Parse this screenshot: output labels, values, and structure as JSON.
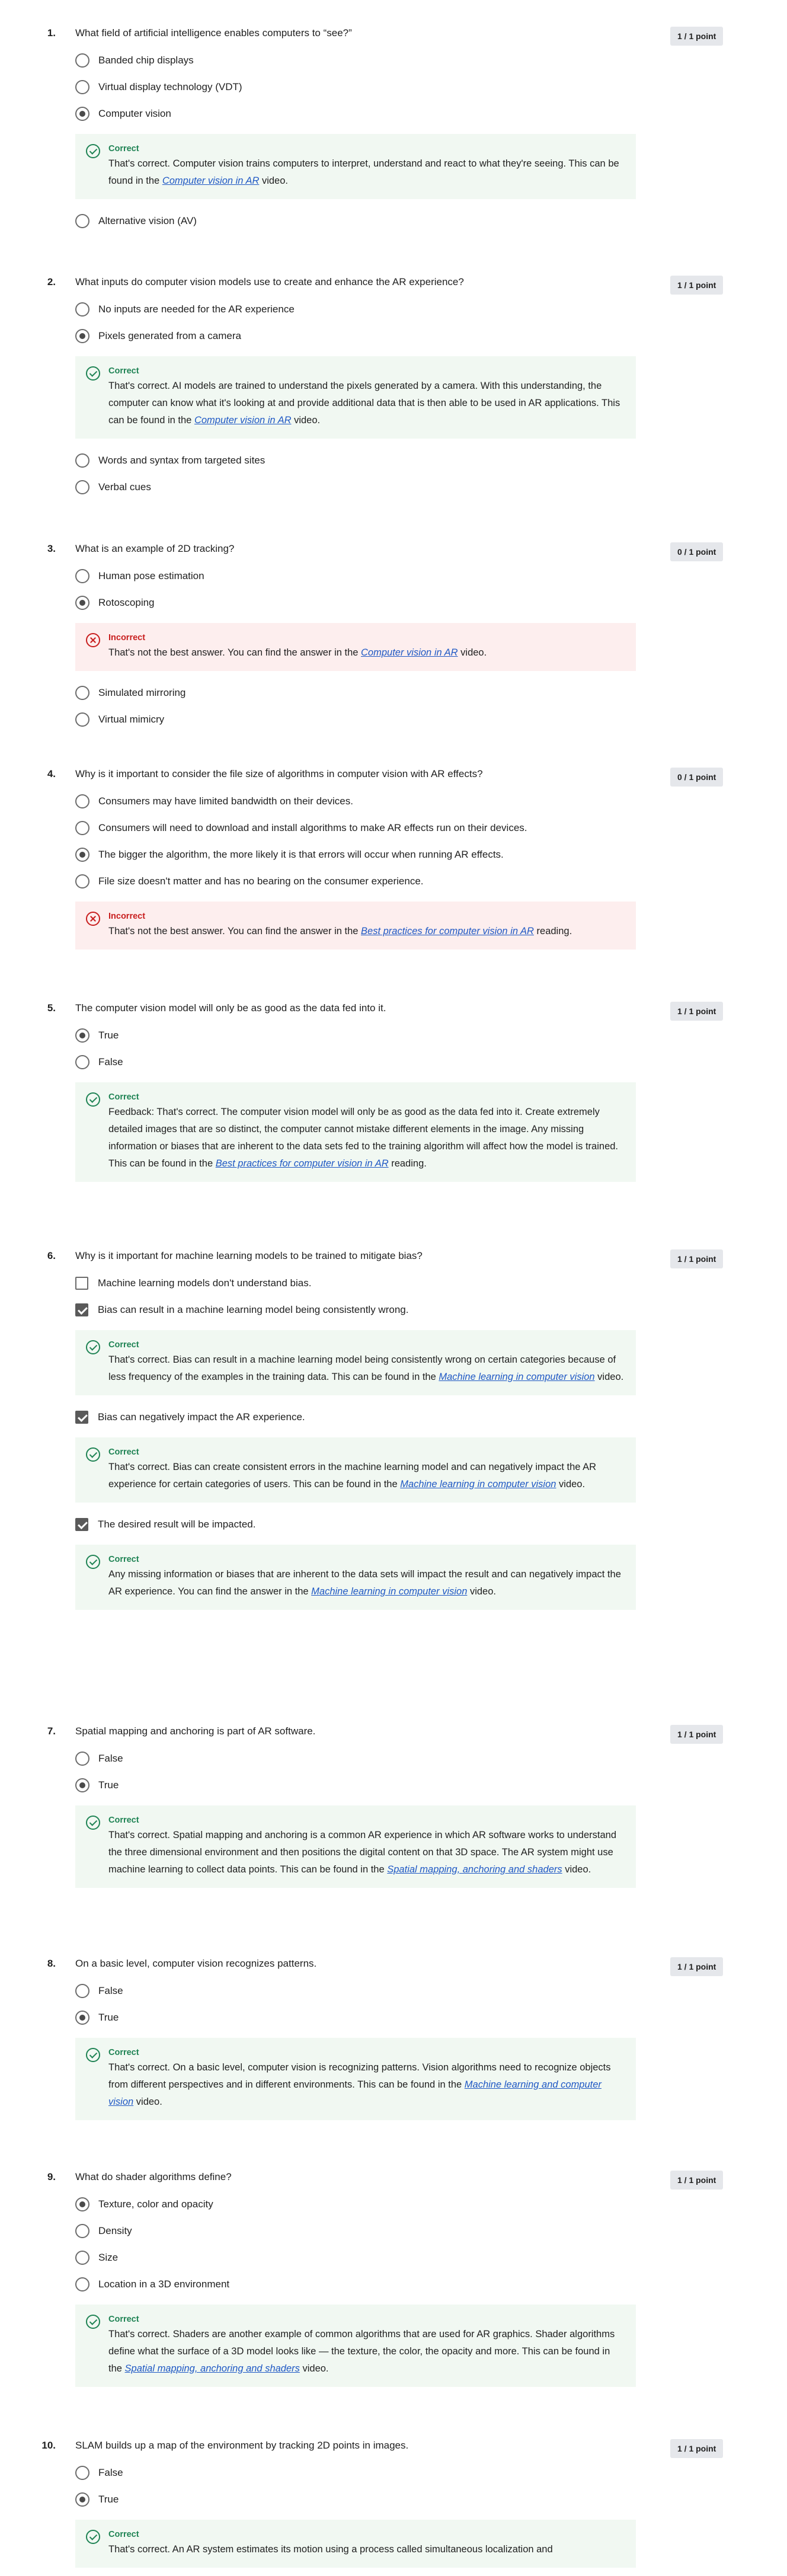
{
  "questions": [
    {
      "num": "1.",
      "text": "What field of artificial intelligence enables computers to “see?”",
      "points": "1 / 1 point",
      "type": "radio",
      "options": [
        {
          "label": "Banded chip displays",
          "selected": false
        },
        {
          "label": "Virtual display technology (VDT)",
          "selected": false
        },
        {
          "label": "Computer vision",
          "selected": true,
          "feedback": {
            "status": "Correct",
            "before": "That's correct. Computer vision trains computers to interpret, understand and react to what they're seeing. This can be found in the ",
            "link": "Computer vision in AR",
            "after": " video."
          }
        },
        {
          "label": "Alternative vision (AV)",
          "selected": false
        }
      ]
    },
    {
      "num": "2.",
      "text": "What inputs do computer vision models use to create and enhance the AR experience?",
      "points": "1 / 1 point",
      "type": "radio",
      "options": [
        {
          "label": "No inputs are needed for the AR experience",
          "selected": false
        },
        {
          "label": "Pixels generated from a camera",
          "selected": true,
          "feedback": {
            "status": "Correct",
            "before": "That's correct. AI models are trained to understand the pixels generated by a camera. With this understanding, the computer can know what it's looking at and provide additional data that is then able to be used in AR applications. This can be found in the ",
            "link": "Computer vision in AR",
            "after": " video."
          }
        },
        {
          "label": "Words and syntax from targeted sites",
          "selected": false
        },
        {
          "label": "Verbal cues",
          "selected": false
        }
      ]
    },
    {
      "num": "3.",
      "text": "What is an example of 2D tracking?",
      "points": "0 / 1 point",
      "type": "radio",
      "options": [
        {
          "label": "Human pose estimation",
          "selected": false
        },
        {
          "label": "Rotoscoping",
          "selected": true,
          "feedback": {
            "status": "Incorrect",
            "before": "That's not the best answer. You can find the answer in the ",
            "link": "Computer vision in AR",
            "after": " video."
          }
        },
        {
          "label": "Simulated mirroring",
          "selected": false
        },
        {
          "label": "Virtual mimicry",
          "selected": false
        }
      ]
    },
    {
      "num": "4.",
      "text": "Why is it important to consider the file size of algorithms in computer vision with AR effects?",
      "points": "0 / 1 point",
      "type": "radio",
      "options": [
        {
          "label": "Consumers may have limited bandwidth on their devices.",
          "selected": false
        },
        {
          "label": "Consumers will need to download and install algorithms to make AR effects run on their devices.",
          "selected": false
        },
        {
          "label": "The bigger the algorithm, the more likely it is that errors will occur when running AR effects.",
          "selected": true
        },
        {
          "label": "File size doesn't matter and has no bearing on the consumer experience.",
          "selected": false,
          "feedback": {
            "status": "Incorrect",
            "before": "That's not the best answer. You can find the answer in the ",
            "link": "Best practices for computer vision in AR",
            "after": " reading."
          }
        }
      ]
    },
    {
      "num": "5.",
      "text": "The computer vision model will only be as good as the data fed into it.",
      "points": "1 / 1 point",
      "type": "radio",
      "options": [
        {
          "label": "True",
          "selected": true
        },
        {
          "label": "False",
          "selected": false,
          "feedback": {
            "status": "Correct",
            "before": "Feedback: That's correct. The computer vision model will only be as good as the data fed into it. Create extremely detailed images that are so distinct, the computer cannot mistake different elements in the image. Any missing information or biases that are inherent to the data sets fed to the training algorithm will affect how the model is trained. This can be found in the ",
            "link": "Best practices for computer vision in AR",
            "after": " reading."
          }
        }
      ]
    },
    {
      "num": "6.",
      "text": "Why is it important for machine learning models to be trained to mitigate bias?",
      "points": "1 / 1 point",
      "type": "check",
      "options": [
        {
          "label": "Machine learning models don't understand bias.",
          "selected": false
        },
        {
          "label": "Bias can result in a machine learning model being consistently wrong.",
          "selected": true,
          "feedback": {
            "status": "Correct",
            "before": "That's correct. Bias can result in a machine learning model being consistently wrong on certain categories because of less frequency of the examples in the training data. This can be found in the ",
            "link": "Machine learning in computer vision",
            "after": " video."
          }
        },
        {
          "label": "Bias can negatively impact the AR experience.",
          "selected": true,
          "feedback": {
            "status": "Correct",
            "before": "That's correct. Bias can create consistent errors in the machine learning model and can negatively impact the AR experience for certain categories of users. This can be found in the ",
            "link": "Machine learning in computer vision",
            "after": " video."
          }
        },
        {
          "label": "The desired result will be impacted.",
          "selected": true,
          "feedback": {
            "status": "Correct",
            "before": "Any missing information or biases that are inherent to the data sets will impact the result and can negatively impact the AR experience. You can find the answer in the ",
            "link": "Machine learning in computer vision",
            "after": " video."
          }
        }
      ]
    },
    {
      "num": "7.",
      "text": "Spatial mapping and anchoring is part of AR software.",
      "points": "1 / 1 point",
      "type": "radio",
      "options": [
        {
          "label": "False",
          "selected": false
        },
        {
          "label": "True",
          "selected": true,
          "feedback": {
            "status": "Correct",
            "before": "That's correct. Spatial mapping and anchoring is a common AR experience in which AR software works to understand the three dimensional environment and then positions the digital content on that 3D space. The AR system might use machine learning to collect data points. This can be found in the ",
            "link": "Spatial mapping, anchoring and shaders",
            "after": " video."
          }
        }
      ]
    },
    {
      "num": "8.",
      "text": "On a basic level, computer vision recognizes patterns.",
      "points": "1 / 1 point",
      "type": "radio",
      "options": [
        {
          "label": "False",
          "selected": false
        },
        {
          "label": "True",
          "selected": true,
          "feedback": {
            "status": "Correct",
            "before": "That's correct. On a basic level, computer vision is recognizing patterns. Vision algorithms need to recognize objects from different perspectives and in different environments. This can be found in the ",
            "link": "Machine learning and computer vision",
            "after": " video."
          }
        }
      ]
    },
    {
      "num": "9.",
      "text": "What do shader algorithms define?",
      "points": "1 / 1 point",
      "type": "radio",
      "options": [
        {
          "label": "Texture, color and opacity",
          "selected": true
        },
        {
          "label": "Density",
          "selected": false
        },
        {
          "label": "Size",
          "selected": false
        },
        {
          "label": "Location in a 3D environment",
          "selected": false,
          "feedback": {
            "status": "Correct",
            "before": "That's correct. Shaders are another example of common algorithms that are used for AR graphics. Shader algorithms define what the surface of a 3D model looks like — the texture, the color, the opacity and more. This can be found in the ",
            "link": "Spatial mapping, anchoring and shaders",
            "after": " video."
          }
        }
      ]
    },
    {
      "num": "10.",
      "text": "SLAM builds up a map of the environment by tracking 2D points in images.",
      "points": "1 / 1 point",
      "type": "radio",
      "options": [
        {
          "label": "False",
          "selected": false
        },
        {
          "label": "True",
          "selected": true,
          "feedback": {
            "status": "Correct",
            "before": "That's correct. An AR system estimates its motion using a process called simultaneous localization and",
            "link": "",
            "after": ""
          }
        }
      ]
    }
  ]
}
